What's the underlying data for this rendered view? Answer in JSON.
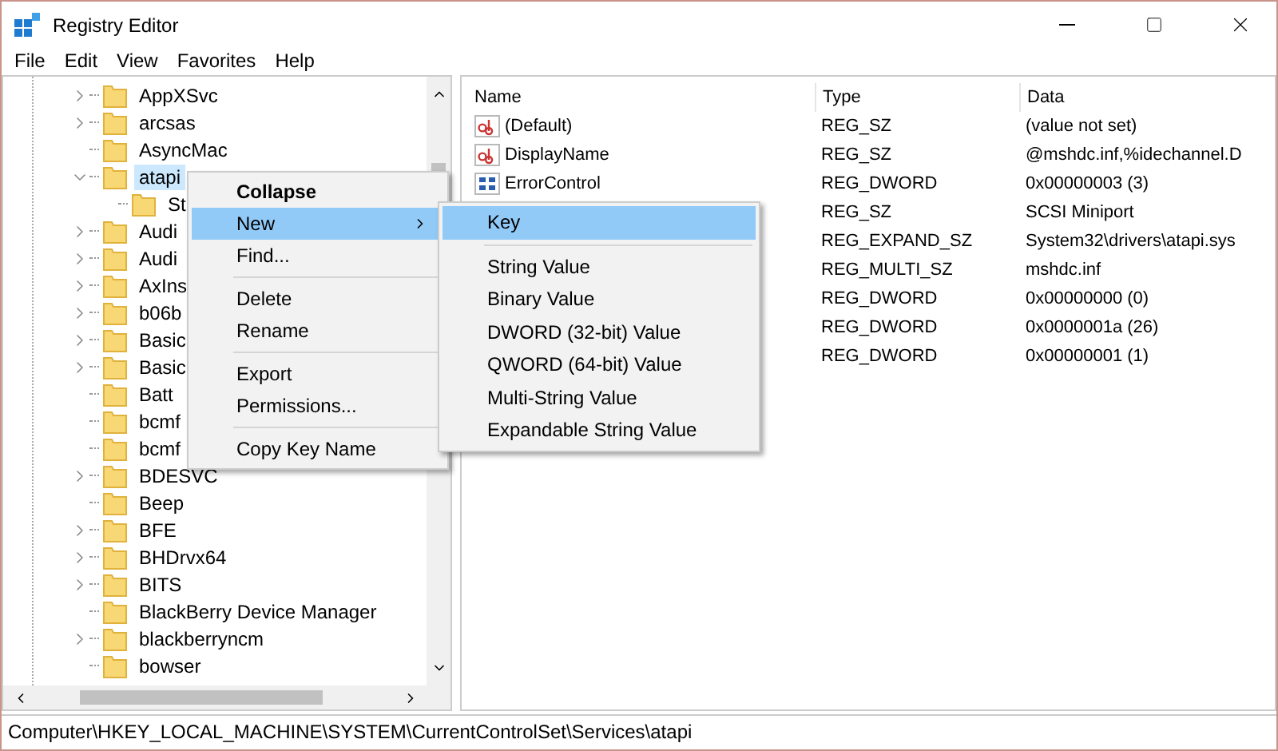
{
  "window": {
    "title": "Registry Editor"
  },
  "menu_bar": [
    "File",
    "Edit",
    "View",
    "Favorites",
    "Help"
  ],
  "tree": [
    {
      "name": "AppXSvc",
      "kind": "node",
      "expanded": false,
      "selected": false
    },
    {
      "name": "arcsas",
      "kind": "node",
      "expanded": false,
      "selected": false
    },
    {
      "name": "AsyncMac",
      "kind": "leaf",
      "selected": false
    },
    {
      "name": "atapi",
      "kind": "node",
      "expanded": true,
      "selected": true,
      "children": [
        {
          "name": "St",
          "kind": "leaf",
          "selected": false
        }
      ]
    },
    {
      "name": "Audi",
      "kind": "node",
      "expanded": false,
      "selected": false
    },
    {
      "name": "Audi",
      "kind": "node",
      "expanded": false,
      "selected": false
    },
    {
      "name": "AxIns",
      "kind": "node",
      "expanded": false,
      "selected": false
    },
    {
      "name": "b06b",
      "kind": "node",
      "expanded": false,
      "selected": false
    },
    {
      "name": "Basic",
      "kind": "node",
      "expanded": false,
      "selected": false
    },
    {
      "name": "Basic",
      "kind": "node",
      "expanded": false,
      "selected": false
    },
    {
      "name": "Batt",
      "kind": "leaf",
      "selected": false
    },
    {
      "name": "bcmf",
      "kind": "leaf",
      "selected": false
    },
    {
      "name": "bcmf",
      "kind": "leaf",
      "selected": false
    },
    {
      "name": "BDESVC",
      "kind": "node",
      "expanded": false,
      "selected": false
    },
    {
      "name": "Beep",
      "kind": "leaf",
      "selected": false
    },
    {
      "name": "BFE",
      "kind": "node",
      "expanded": false,
      "selected": false
    },
    {
      "name": "BHDrvx64",
      "kind": "node",
      "expanded": false,
      "selected": false
    },
    {
      "name": "BITS",
      "kind": "node",
      "expanded": false,
      "selected": false
    },
    {
      "name": "BlackBerry Device Manager",
      "kind": "leaf",
      "selected": false
    },
    {
      "name": "blackberryncm",
      "kind": "node",
      "expanded": false,
      "selected": false
    },
    {
      "name": "bowser",
      "kind": "leaf",
      "selected": false
    }
  ],
  "values": {
    "columns": [
      "Name",
      "Type",
      "Data"
    ],
    "rows": [
      {
        "kind": "string",
        "name": "(Default)",
        "type": "REG_SZ",
        "data": "(value not set)"
      },
      {
        "kind": "string",
        "name": "DisplayName",
        "type": "REG_SZ",
        "data": "@mshdc.inf,%idechannel.D"
      },
      {
        "kind": "binary",
        "name": "ErrorControl",
        "type": "REG_DWORD",
        "data": "0x00000003 (3)"
      },
      {
        "type": "REG_SZ",
        "data": "SCSI Miniport"
      },
      {
        "type": "REG_EXPAND_SZ",
        "data": "System32\\drivers\\atapi.sys"
      },
      {
        "type": "REG_MULTI_SZ",
        "data": "mshdc.inf"
      },
      {
        "type": "REG_DWORD",
        "data": "0x00000000 (0)"
      },
      {
        "type": "REG_DWORD",
        "data": "0x0000001a (26)"
      },
      {
        "type": "REG_DWORD",
        "data": "0x00000001 (1)"
      }
    ]
  },
  "context_menu": [
    {
      "kind": "item",
      "label": "Collapse",
      "bold": true,
      "selected": false,
      "submenu": false
    },
    {
      "kind": "item",
      "label": "New",
      "bold": false,
      "selected": true,
      "submenu": true
    },
    {
      "kind": "item",
      "label": "Find...",
      "bold": false,
      "selected": false,
      "submenu": false
    },
    {
      "kind": "separator"
    },
    {
      "kind": "item",
      "label": "Delete",
      "bold": false,
      "selected": false,
      "submenu": false
    },
    {
      "kind": "item",
      "label": "Rename",
      "bold": false,
      "selected": false,
      "submenu": false
    },
    {
      "kind": "separator"
    },
    {
      "kind": "item",
      "label": "Export",
      "bold": false,
      "selected": false,
      "submenu": false
    },
    {
      "kind": "item",
      "label": "Permissions...",
      "bold": false,
      "selected": false,
      "submenu": false
    },
    {
      "kind": "separator"
    },
    {
      "kind": "item",
      "label": "Copy Key Name",
      "bold": false,
      "selected": false,
      "submenu": false
    }
  ],
  "submenu": [
    {
      "kind": "item",
      "label": "Key",
      "selected": true
    },
    {
      "kind": "separator"
    },
    {
      "kind": "item",
      "label": "String Value",
      "selected": false
    },
    {
      "kind": "item",
      "label": "Binary Value",
      "selected": false
    },
    {
      "kind": "item",
      "label": "DWORD (32-bit) Value",
      "selected": false
    },
    {
      "kind": "item",
      "label": "QWORD (64-bit) Value",
      "selected": false
    },
    {
      "kind": "item",
      "label": "Multi-String Value",
      "selected": false
    },
    {
      "kind": "item",
      "label": "Expandable String Value",
      "selected": false
    }
  ],
  "status_bar": "Computer\\HKEY_LOCAL_MACHINE\\SYSTEM\\CurrentControlSet\\Services\\atapi"
}
